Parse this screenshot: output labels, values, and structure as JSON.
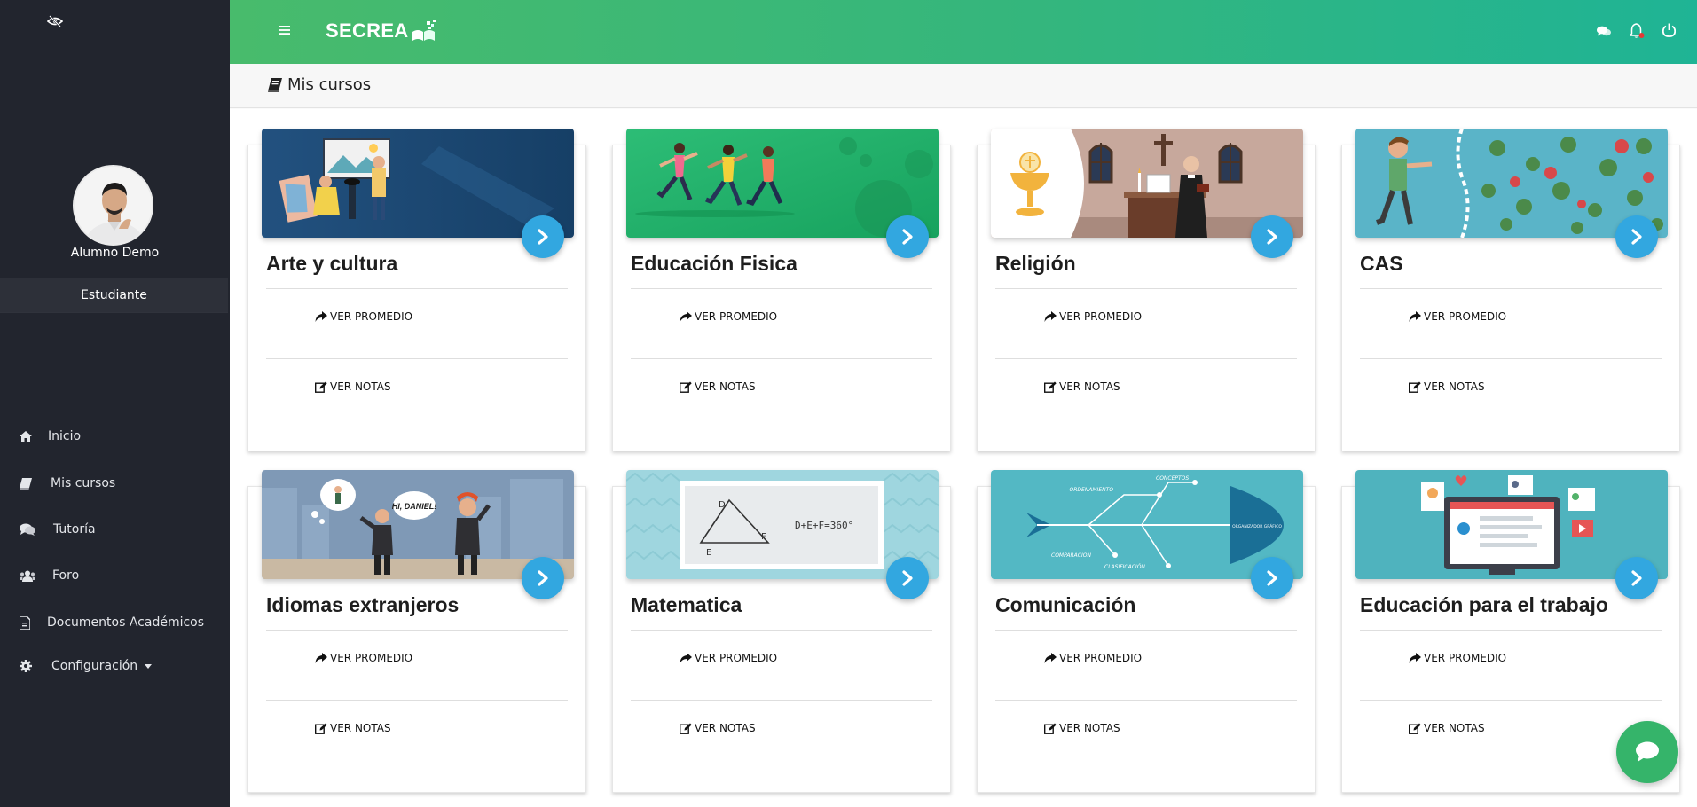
{
  "sidebar": {
    "user_name": "Alumno Demo",
    "role": "Estudiante",
    "items": [
      {
        "label": "Inicio",
        "icon": "home-icon"
      },
      {
        "label": "Mis cursos",
        "icon": "book-icon"
      },
      {
        "label": "Tutoría",
        "icon": "comments-icon"
      },
      {
        "label": "Foro",
        "icon": "users-icon"
      },
      {
        "label": "Documentos Académicos",
        "icon": "document-icon"
      },
      {
        "label": "Configuración",
        "icon": "gear-icon"
      }
    ]
  },
  "topbar": {
    "logo": "SECREA",
    "icons": [
      "menu-icon",
      "chat-icon",
      "bell-icon",
      "power-icon"
    ]
  },
  "page": {
    "title": "Mis cursos"
  },
  "courses": [
    {
      "title": "Arte y cultura",
      "promedio_label": "VER PROMEDIO",
      "notas_label": "VER NOTAS"
    },
    {
      "title": "Educación Fisica",
      "promedio_label": "VER PROMEDIO",
      "notas_label": "VER NOTAS"
    },
    {
      "title": "Religión",
      "promedio_label": "VER PROMEDIO",
      "notas_label": "VER NOTAS"
    },
    {
      "title": "CAS",
      "promedio_label": "VER PROMEDIO",
      "notas_label": "VER NOTAS"
    },
    {
      "title": "Idiomas extranjeros",
      "promedio_label": "VER PROMEDIO",
      "notas_label": "VER NOTAS"
    },
    {
      "title": "Matematica",
      "promedio_label": "VER PROMEDIO",
      "notas_label": "VER NOTAS"
    },
    {
      "title": "Comunicación",
      "promedio_label": "VER PROMEDIO",
      "notas_label": "VER NOTAS"
    },
    {
      "title": "Educación para el trabajo",
      "promedio_label": "VER PROMEDIO",
      "notas_label": "VER NOTAS"
    }
  ],
  "banner_text": {
    "idiomas_bubble": "HI, DANIEL!",
    "matematica_d": "D",
    "matematica_e": "E",
    "matematica_f": "F",
    "matematica_formula": "D+E+F=360°",
    "comunicacion_1": "CONCEPTOS",
    "comunicacion_2": "ORDENAMIENTO",
    "comunicacion_3": "COMPARACIÓN",
    "comunicacion_4": "CLASIFICACIÓN",
    "comunicacion_5": "ORGANIZADOR GRÁFICO"
  },
  "colors": {
    "sidebar_bg": "#22252e",
    "topbar_start": "#48bb6c",
    "topbar_end": "#1fb495",
    "button_blue": "#32a7e0",
    "fab_green": "#35b46a"
  }
}
